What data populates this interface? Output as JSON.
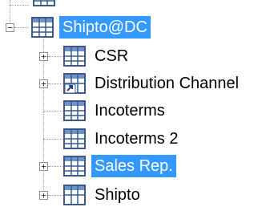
{
  "tree": {
    "root": {
      "label": "Shipto@DC",
      "expanded": true,
      "selected": true,
      "icon": "table-icon"
    },
    "children": [
      {
        "label": "CSR",
        "expander": "+",
        "icon": "table-icon",
        "selected": false
      },
      {
        "label": "Distribution Channel",
        "expander": "+",
        "icon": "table-link-icon",
        "selected": false
      },
      {
        "label": "Incoterms",
        "expander": "",
        "icon": "table-icon",
        "selected": false
      },
      {
        "label": "Incoterms 2",
        "expander": "",
        "icon": "table-icon",
        "selected": false
      },
      {
        "label": "Sales Rep.",
        "expander": "+",
        "icon": "table-icon",
        "selected": true
      },
      {
        "label": "Shipto",
        "expander": "+",
        "icon": "table-icon",
        "selected": false
      }
    ],
    "root_expander": "−"
  },
  "colors": {
    "selection": "#3399ff",
    "icon_border": "#3c5a8c",
    "icon_header": "#6f93c9",
    "guide_line": "#9a9a9a"
  }
}
